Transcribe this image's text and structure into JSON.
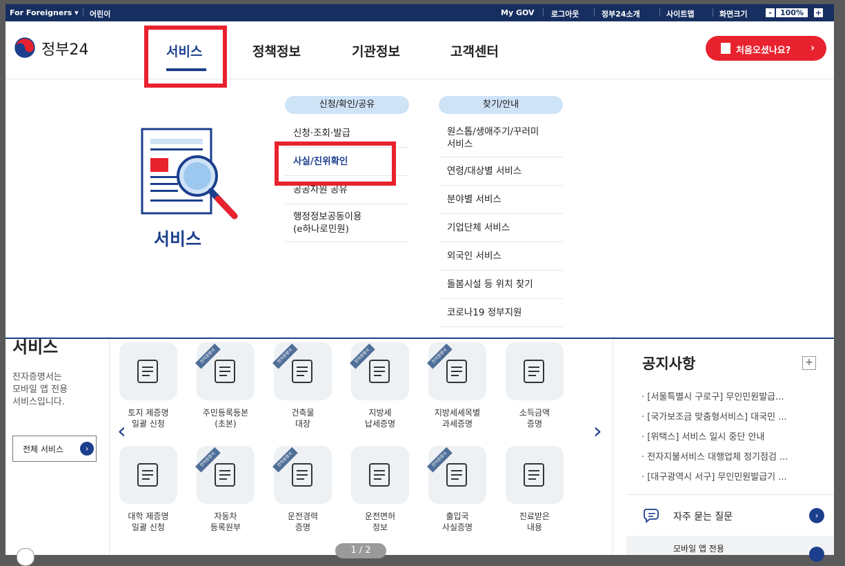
{
  "colors": {
    "brand_navy": "#172f60",
    "primary_blue": "#1b3f8c",
    "accent_red": "#e8222e",
    "pill_blue": "#cfe3f7"
  },
  "utility_bar": {
    "foreigners": "For Foreigners ▾",
    "children": "어린이",
    "my_gov": "My GOV",
    "logout": "로그아웃",
    "about": "정부24소개",
    "sitemap": "사이트맵",
    "screen_size": "화면크기",
    "zoom_minus": "-",
    "zoom_value": "100%",
    "zoom_plus": "+"
  },
  "header": {
    "logo_text": "정부24",
    "nav": [
      "서비스",
      "정책정보",
      "기관정보",
      "고객센터"
    ],
    "active_nav": "서비스",
    "first_visit": "처음오셨나요?",
    "first_visit_arrow": "›"
  },
  "mega_menu": {
    "title": "서비스",
    "col1": {
      "heading": "신청/확인/공유",
      "items": [
        "신청·조회·발급",
        "사실/진위확인",
        "공공자원 공유",
        "행정정보공동이용",
        "(e하나로민원)"
      ],
      "highlighted": "사실/진위확인"
    },
    "col2": {
      "heading": "찾기/안내",
      "items": [
        "원스톱/생애주기/꾸러미",
        "서비스",
        "연령/대상별 서비스",
        "분야별 서비스",
        "기업단체 서비스",
        "외국인 서비스",
        "돌봄시설 등 위치 찾기",
        "코로나19 정부지원"
      ]
    }
  },
  "lower": {
    "title": "서비스",
    "desc": [
      "전자증명서는",
      "모바일 앱 전용",
      "서비스입니다."
    ],
    "all_services": "전체 서비스",
    "all_services_icon": "›",
    "prev_arrow": "‹",
    "next_arrow": "›",
    "ribbon": "전자증명서",
    "services": [
      {
        "l1": "토지 제증명",
        "l2": "일괄 신청",
        "icon": "land-map-icon",
        "ribbon": false
      },
      {
        "l1": "주민등록등본",
        "l2": "(초본)",
        "icon": "id-card-icon",
        "ribbon": true
      },
      {
        "l1": "건축물",
        "l2": "대장",
        "icon": "building-doc-icon",
        "ribbon": true
      },
      {
        "l1": "지방세",
        "l2": "납세증명",
        "icon": "tax-doc-icon",
        "ribbon": true
      },
      {
        "l1": "지방세세목별",
        "l2": "과세증명",
        "icon": "chart-board-icon",
        "ribbon": true
      },
      {
        "l1": "소득금액",
        "l2": "증명",
        "icon": "coins-doc-icon",
        "ribbon": false
      },
      {
        "l1": "대학 제증명",
        "l2": "일괄 신청",
        "icon": "graduation-cap-icon",
        "ribbon": false
      },
      {
        "l1": "자동차",
        "l2": "등록원부",
        "icon": "car-doc-icon",
        "ribbon": true
      },
      {
        "l1": "운전경력",
        "l2": "증명",
        "icon": "driver-doc-icon",
        "ribbon": true
      },
      {
        "l1": "운전면허",
        "l2": "정보",
        "icon": "license-car-icon",
        "ribbon": false
      },
      {
        "l1": "출입국",
        "l2": "사실증명",
        "icon": "passport-icon",
        "ribbon": true
      },
      {
        "l1": "진료받은",
        "l2": "내용",
        "icon": "medical-record-icon",
        "ribbon": false
      }
    ],
    "pager": "1 / 2"
  },
  "notices": {
    "title": "공지사항",
    "more": "+",
    "items": [
      "[서울특별시 구로구] 무인민원발급...",
      "[국가보조금 맞춤형서비스] 대국민 ...",
      "[위택스] 서비스 일시 중단 안내",
      "전자지불서비스 대행업체 정기점검 ...",
      "[대구광역시 서구] 무인민원발급기 ..."
    ],
    "faq": "자주 묻는 질문",
    "faq_arrow": "›",
    "mobile": "모바일 앱 전용"
  }
}
